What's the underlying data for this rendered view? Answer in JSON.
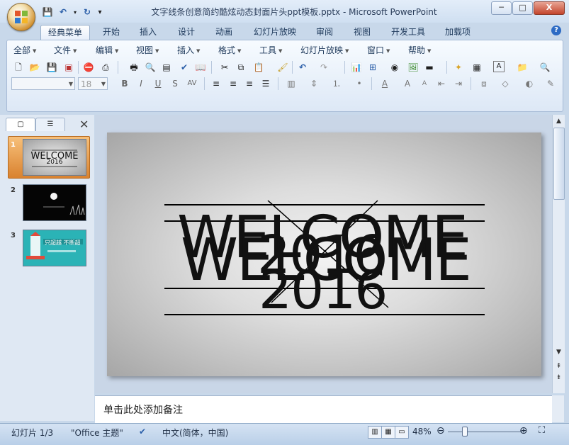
{
  "window": {
    "title": "文字线条创意简约酷炫动态封面片头ppt模板.pptx - Microsoft PowerPoint",
    "controls": {
      "minimize": "─",
      "maximize": "□",
      "close": "X"
    }
  },
  "quick_access": {
    "save": "💾",
    "undo": "↶",
    "redo": "↻",
    "customize": "▾"
  },
  "ribbon_tabs": [
    "经典菜单",
    "开始",
    "插入",
    "设计",
    "动画",
    "幻灯片放映",
    "审阅",
    "视图",
    "开发工具",
    "加载项"
  ],
  "active_tab": "经典菜单",
  "help": "?",
  "menubar": [
    "全部",
    "文件",
    "编辑",
    "视图",
    "插入",
    "格式",
    "工具",
    "幻灯片放映",
    "窗口",
    "帮助"
  ],
  "toolbar": {
    "font_name": "",
    "font_size": "18",
    "bold": "B",
    "italic": "I",
    "underline": "U",
    "shadow": "S",
    "font_color": "A"
  },
  "slides_panel": {
    "tab_slides_icon": "▢",
    "tab_outline_icon": "☰",
    "close": "✕",
    "slides": [
      {
        "number": "1",
        "selected": true
      },
      {
        "number": "2",
        "selected": false
      },
      {
        "number": "3",
        "selected": false
      }
    ],
    "thumb3_text": "只超越 不断超"
  },
  "slide": {
    "line1": "WELCOME",
    "line2": "WELCOME",
    "year1": "2016",
    "year2": "2016"
  },
  "notes": {
    "placeholder": "单击此处添加备注"
  },
  "statusbar": {
    "slide_info": "幻灯片 1/3",
    "theme": "\"Office 主题\"",
    "language": "中文(简体，中国)",
    "zoom": "48%"
  }
}
